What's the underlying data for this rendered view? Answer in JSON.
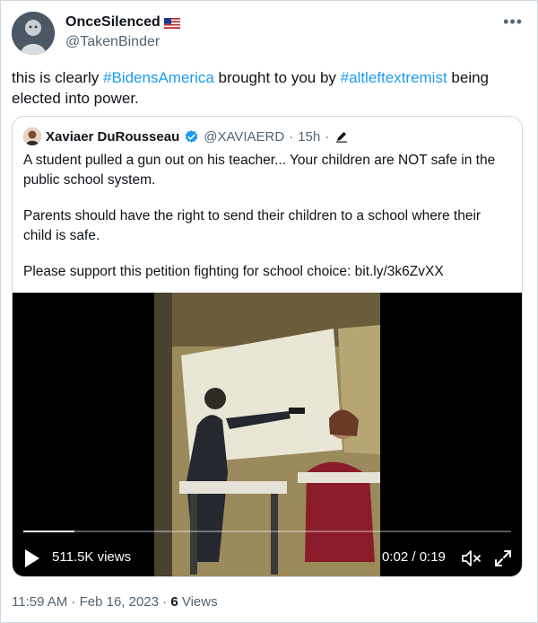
{
  "author": {
    "name": "OnceSilenced",
    "handle": "@TakenBinder"
  },
  "tweet": {
    "text_before": "this is clearly ",
    "hashtag1": "#BidensAmerica",
    "text_middle": " brought to you by  ",
    "hashtag2": "#altleftextremist",
    "text_after": " being elected into power."
  },
  "quote": {
    "name": "Xaviaer DuRousseau",
    "handle": "@XAVIAERD",
    "separator": "·",
    "time": "15h",
    "paragraphs": [
      "A student pulled a gun out on his teacher... Your children are NOT safe in the public school system.",
      "Parents should have the right to send their children to a school where their child is safe.",
      "Please support this petition fighting for school choice: bit.ly/3k6ZvXX"
    ]
  },
  "video": {
    "views": "511.5K views",
    "timecode": "0:02 / 0:19",
    "progress": 0.105
  },
  "footer": {
    "time": "11:59 AM · Feb 16, 2023 · ",
    "views_count": "6",
    "views_label": " Views"
  },
  "colors": {
    "link": "#1d9bf0",
    "secondary_text": "#536471",
    "border": "#cfd9de"
  },
  "icons": [
    "flag-us-icon",
    "more-icon",
    "verified-icon",
    "edit-pencil-icon",
    "play-icon",
    "mute-icon",
    "fullscreen-icon"
  ]
}
